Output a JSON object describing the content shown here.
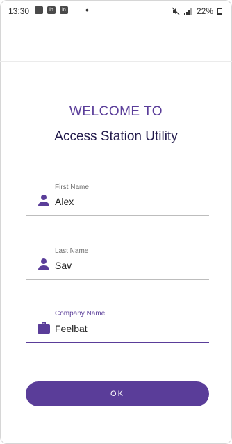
{
  "status_bar": {
    "time": "13:30",
    "battery": "22%",
    "dot": "•",
    "notification_icons": [
      "image-icon",
      "linkedin-icon",
      "linkedin-icon"
    ]
  },
  "welcome_text": "WELCOME TO",
  "app_title": "Access Station Utility",
  "form": {
    "first_name": {
      "label": "First Name",
      "value": "Alex",
      "icon": "person-icon"
    },
    "last_name": {
      "label": "Last Name",
      "value": "Sav",
      "icon": "person-icon"
    },
    "company_name": {
      "label": "Company Name",
      "value": "Feelbat",
      "icon": "briefcase-icon",
      "focused": true
    }
  },
  "ok_button": {
    "label": "OK"
  },
  "colors": {
    "accent": "#5a3d99",
    "title": "#221a4b"
  }
}
